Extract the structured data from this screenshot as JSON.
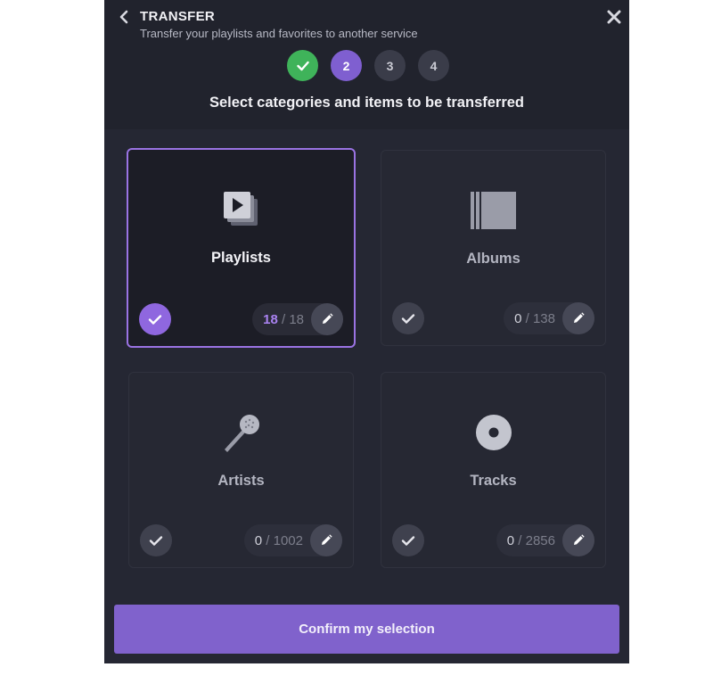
{
  "header": {
    "title": "TRANSFER",
    "subtitle": "Transfer your playlists and favorites to another service",
    "back_icon": "chevron-left-icon",
    "close_icon": "close-icon"
  },
  "stepper": {
    "current": 2,
    "steps": [
      {
        "label": "✓",
        "state": "completed"
      },
      {
        "label": "2",
        "state": "active"
      },
      {
        "label": "3",
        "state": "pending"
      },
      {
        "label": "4",
        "state": "pending"
      }
    ]
  },
  "instruction": "Select categories and items to be transferred",
  "categories": [
    {
      "label": "Playlists",
      "icon": "playlist-stack-icon",
      "selected_count": "18",
      "separator": "/",
      "total": "18",
      "selected": true
    },
    {
      "label": "Albums",
      "icon": "album-icon",
      "selected_count": "0",
      "separator": "/",
      "total": "138",
      "selected": false
    },
    {
      "label": "Artists",
      "icon": "microphone-icon",
      "selected_count": "0",
      "separator": "/",
      "total": "1002",
      "selected": false
    },
    {
      "label": "Tracks",
      "icon": "disc-icon",
      "selected_count": "0",
      "separator": "/",
      "total": "2856",
      "selected": false
    }
  ],
  "confirm_label": "Confirm my selection",
  "colors": {
    "panel_bg": "#252733",
    "accent_purple": "#8062cc",
    "selected_border": "#9a73e3",
    "step_done": "#3fb35a"
  }
}
